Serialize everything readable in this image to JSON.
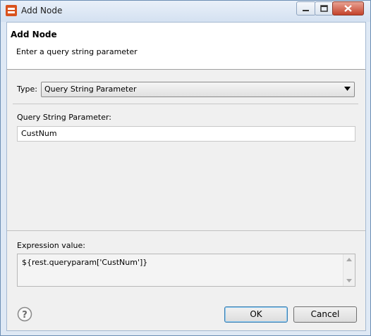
{
  "window": {
    "title": "Add Node",
    "icon": "app-logo-icon",
    "controls": [
      "minimize-icon",
      "maximize-icon",
      "close-icon"
    ]
  },
  "header": {
    "title": "Add Node",
    "subtitle": "Enter a query string parameter"
  },
  "form": {
    "type_label": "Type:",
    "type_value": "Query String Parameter",
    "param_label": "Query String Parameter:",
    "param_value": "CustNum",
    "expression_label": "Expression value:",
    "expression_value": "${rest.queryparam['CustNum']}"
  },
  "buttons": {
    "ok": "OK",
    "cancel": "Cancel",
    "help_icon": "help-question-icon"
  },
  "colors": {
    "title_bar": "#dfe9f5",
    "client_bg": "#f0f0f0",
    "header_bg": "#ffffff",
    "close_button": "#c4432b",
    "app_icon": "#d9531e"
  }
}
